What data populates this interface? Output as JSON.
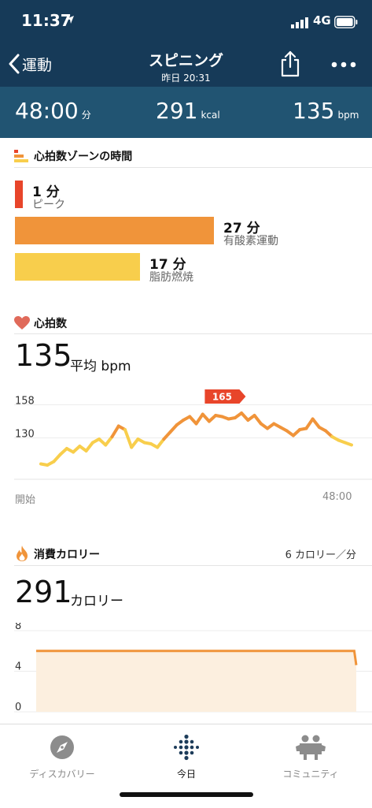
{
  "status_bar": {
    "time": "11:37",
    "network": "4G"
  },
  "nav": {
    "back_label": "運動",
    "title": "スピニング",
    "subtitle": "昨日 20:31"
  },
  "stats": [
    {
      "value": "48:00",
      "unit": "分"
    },
    {
      "value": "291",
      "unit": "kcal"
    },
    {
      "value": "135",
      "unit": "bpm"
    }
  ],
  "zones": {
    "title": "心拍数ゾーンの時間",
    "items": [
      {
        "value": "1 分",
        "label": "ピーク",
        "minutes": 1,
        "color": "#e8452a"
      },
      {
        "value": "27 分",
        "label": "有酸素運動",
        "minutes": 27,
        "color": "#f0943a"
      },
      {
        "value": "17 分",
        "label": "脂肪燃焼",
        "minutes": 17,
        "color": "#f8ce4c"
      }
    ]
  },
  "heart_rate": {
    "title": "心拍数",
    "avg_value": "135",
    "avg_unit": "平均 bpm",
    "peak_label": "165",
    "start_label": "開始",
    "end_label": "48:00"
  },
  "calories": {
    "title": "消費カロリー",
    "rate": "6 カロリー／分",
    "total": "291",
    "unit": "カロリー"
  },
  "chart_data": [
    {
      "type": "line",
      "title": "心拍数",
      "yticks": [
        "158",
        "130"
      ],
      "xlabels": [
        "開始",
        "48:00"
      ],
      "ylim": [
        95,
        175
      ],
      "x": [
        0,
        1,
        2,
        3,
        4,
        5,
        6,
        7,
        8,
        9,
        10,
        11,
        12,
        13,
        14,
        15,
        16,
        17,
        18,
        19,
        20,
        21,
        22,
        23,
        24,
        25,
        26,
        27,
        28,
        29,
        30,
        31,
        32,
        33,
        34,
        35,
        36,
        37,
        38,
        39,
        40,
        41,
        42,
        43,
        44,
        45,
        46,
        47,
        48
      ],
      "series": [
        {
          "values": [
            108,
            107,
            110,
            116,
            121,
            118,
            123,
            119,
            126,
            129,
            124,
            131,
            140,
            137,
            122,
            129,
            126,
            125,
            122,
            129,
            135,
            141,
            145,
            148,
            142,
            150,
            144,
            149,
            148,
            146,
            147,
            151,
            145,
            149,
            142,
            138,
            142,
            139,
            136,
            132,
            137,
            138,
            146,
            139,
            136,
            131,
            128,
            126,
            124
          ]
        }
      ],
      "peak": {
        "x": 28,
        "value": 165
      },
      "zone_colors": {
        "above_130": "#f0943a",
        "below_130": "#f8ce4c"
      }
    },
    {
      "type": "area",
      "title": "消費カロリー",
      "yticks": [
        "8",
        "4",
        "0"
      ],
      "ylim": [
        0,
        8
      ],
      "x": [
        0,
        47,
        47.3
      ],
      "values": [
        6,
        6,
        4.6
      ],
      "color": "#f0943a"
    }
  ],
  "tabs": [
    {
      "label": "ディスカバリー",
      "icon": "compass-icon"
    },
    {
      "label": "今日",
      "icon": "fitbit-dots-icon"
    },
    {
      "label": "コミュニティ",
      "icon": "community-icon"
    }
  ]
}
